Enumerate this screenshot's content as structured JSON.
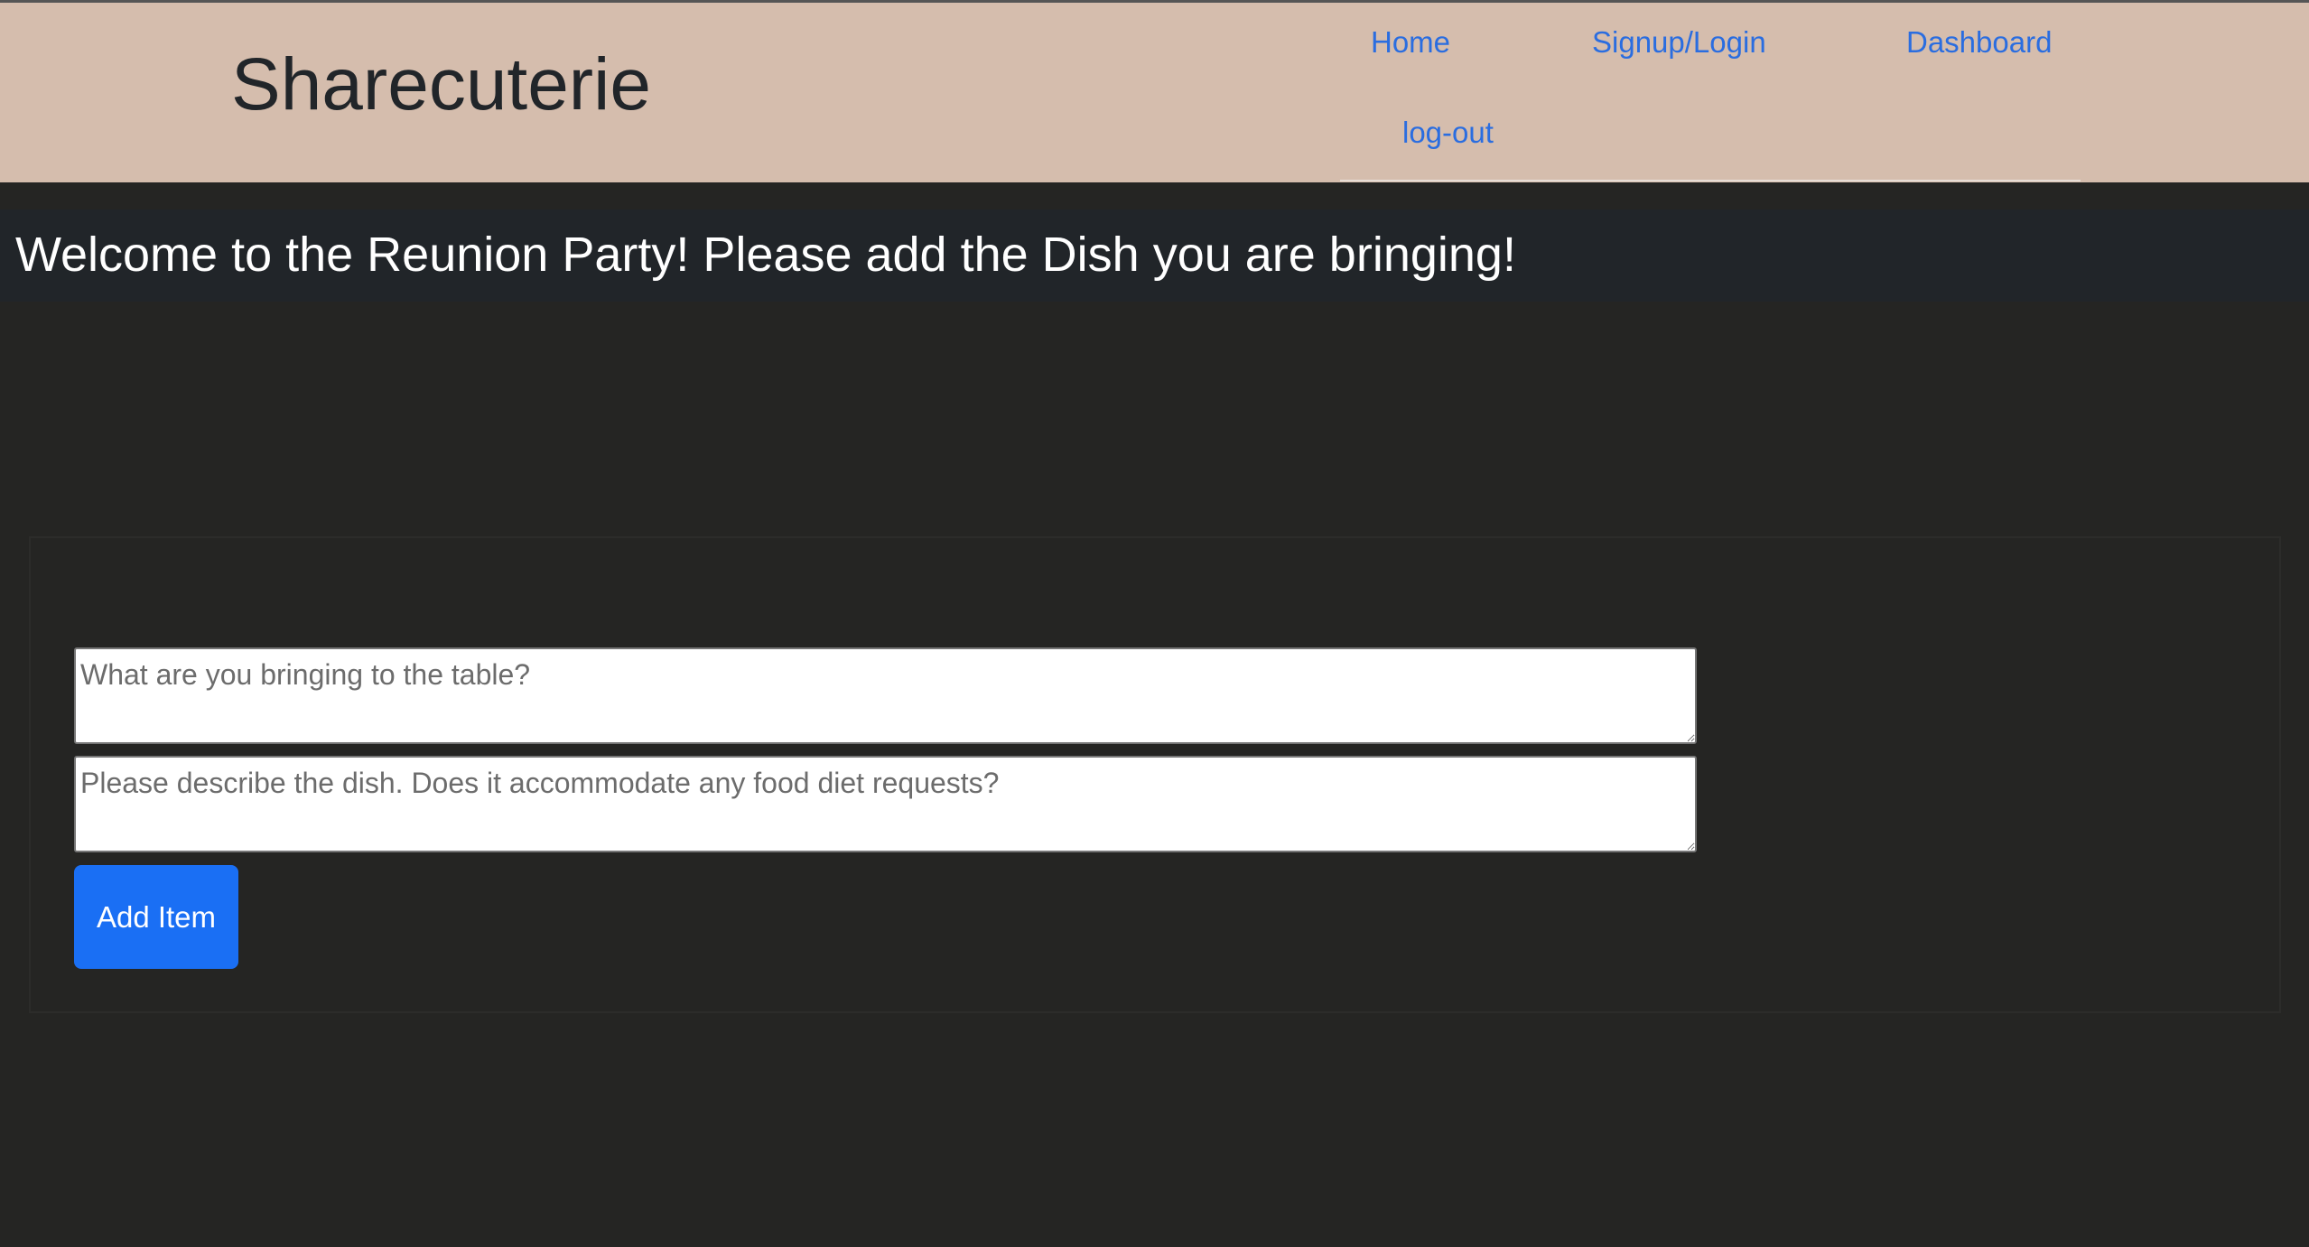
{
  "header": {
    "brand": "Sharecuterie",
    "nav": {
      "home": "Home",
      "signup_login": "Signup/Login",
      "dashboard": "Dashboard",
      "logout": "log-out"
    }
  },
  "banner": {
    "text": "Welcome to the Reunion Party! Please add the Dish you are bringing!"
  },
  "form": {
    "dish_name_placeholder": "What are you bringing to the table?",
    "dish_name_value": "",
    "description_placeholder": "Please describe the dish. Does it accommodate any food diet requests?",
    "description_value": "",
    "submit_label": "Add Item"
  },
  "colors": {
    "header_bg": "#d5bdad",
    "page_bg": "#252523",
    "banner_bg": "#212529",
    "link": "#2a6de0",
    "button": "#1a6ff4"
  }
}
